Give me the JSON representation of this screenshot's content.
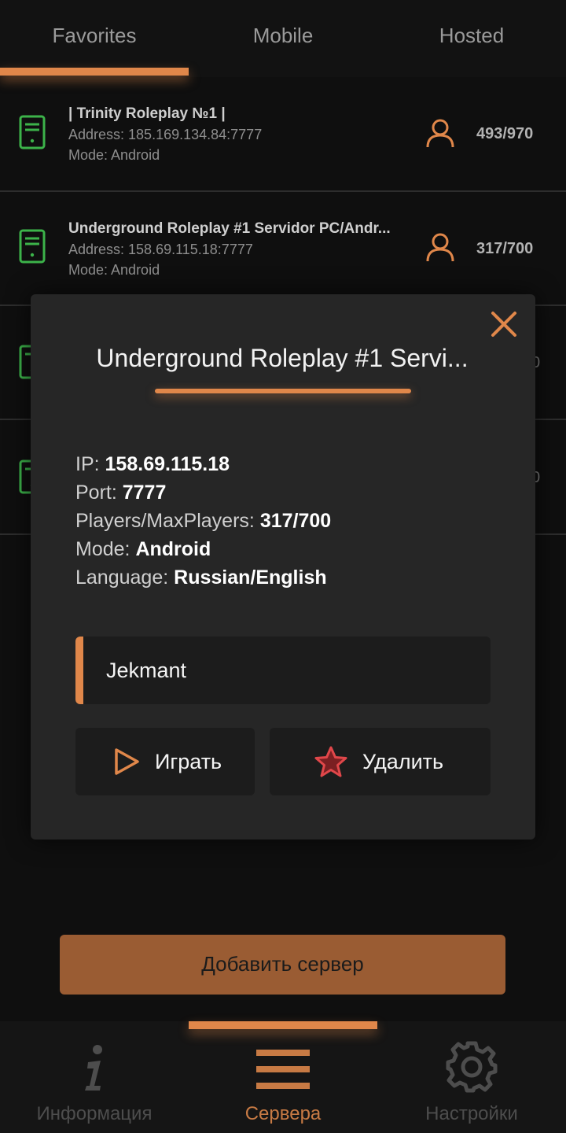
{
  "tabs": [
    {
      "label": "Favorites"
    },
    {
      "label": "Mobile"
    },
    {
      "label": "Hosted"
    }
  ],
  "servers": [
    {
      "name": "|       Trinity Roleplay  №1       |",
      "address": "Address: 185.169.134.84:7777",
      "mode": "Mode: Android",
      "players": "493/970"
    },
    {
      "name": "Underground Roleplay #1 Servidor PC/Andr...",
      "address": "Address: 158.69.115.18:7777",
      "mode": "Mode: Android",
      "players": "317/700"
    }
  ],
  "peek": {
    "row3": "0",
    "row4": "0"
  },
  "dialog": {
    "title": "Underground Roleplay #1 Servi...",
    "ip_label": "IP:",
    "ip": "158.69.115.18",
    "port_label": "Port:",
    "port": "7777",
    "players_label": "Players/MaxPlayers:",
    "players": "317/700",
    "mode_label": "Mode:",
    "mode": "Android",
    "language_label": "Language:",
    "language": "Russian/English",
    "nickname": "Jekmant",
    "play_label": "Играть",
    "delete_label": "Удалить"
  },
  "add_server_label": "Добавить сервер",
  "bottom_nav": [
    {
      "label": "Информация",
      "icon": "info-icon"
    },
    {
      "label": "Сервера",
      "icon": "menu-icon"
    },
    {
      "label": "Настройки",
      "icon": "gear-icon"
    }
  ],
  "colors": {
    "accent": "#e0874a",
    "server_icon": "#3cb34a",
    "star": "#e0474a",
    "add_button": "#9a5c33"
  }
}
